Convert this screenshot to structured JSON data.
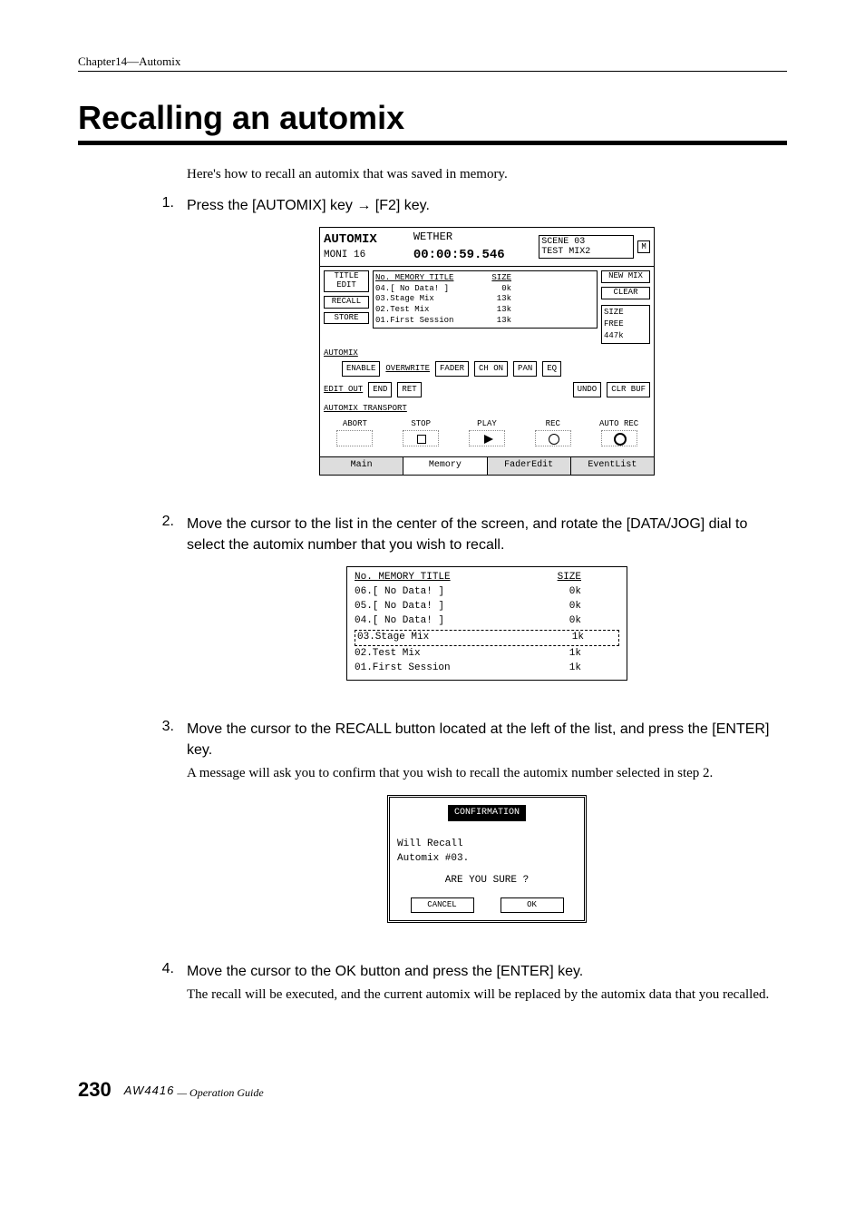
{
  "chapter_line": "Chapter14—Automix",
  "heading": "Recalling an automix",
  "intro": "Here's how to recall an automix that was saved in memory.",
  "steps": [
    {
      "num": "1.",
      "cmd": "Press the [AUTOMIX] key → [F2] key."
    },
    {
      "num": "2.",
      "cmd": "Move the cursor to the list in the center of the screen, and rotate the [DATA/JOG] dial to select the automix number that you wish to recall."
    },
    {
      "num": "3.",
      "cmd": "Move the cursor to the RECALL button located at the left of the list, and press the [ENTER] key.",
      "sub": "A message will ask you to confirm that you wish to recall the automix number selected in step 2."
    },
    {
      "num": "4.",
      "cmd": "Move the cursor to the OK button and press the [ENTER] key.",
      "sub": "The recall will be executed, and the current automix will be replaced by the automix data that you recalled."
    }
  ],
  "lcd_main": {
    "top_left_1": "AUTOMIX",
    "top_left_2": "MONI 16",
    "tc_label": "WETHER",
    "timecode": "00:00:59.546",
    "scene_label": "SCENE",
    "scene_num": "03",
    "scene_name": "TEST MIX2",
    "m": "M",
    "side": {
      "title": "TITLE\nEDIT",
      "recall": "RECALL",
      "store": "STORE"
    },
    "list_hdr_no": "No.  MEMORY TITLE",
    "list_hdr_sz": "SIZE",
    "rows": [
      {
        "t": "04.[   No Data!   ]",
        "s": "0k"
      },
      {
        "t": "03.Stage Mix",
        "s": "13k"
      },
      {
        "t": "02.Test Mix",
        "s": "13k"
      },
      {
        "t": "01.First Session",
        "s": "13k"
      }
    ],
    "right": {
      "new": "NEW\nMIX",
      "clear": "CLEAR",
      "size_label": "SIZE",
      "free": "FREE  447k"
    },
    "automix_label": "AUTOMIX",
    "overwrite_label": "OVERWRITE",
    "ow_btns": {
      "enable": "ENABLE",
      "fader": "FADER",
      "chon": "CH ON",
      "pan": "PAN",
      "eq": "EQ"
    },
    "editout_label": "EDIT OUT",
    "editout_btns": {
      "end": "END",
      "ret": "RET",
      "undo": "UNDO",
      "clrbuf": "CLR BUF"
    },
    "transport_label": "AUTOMIX TRANSPORT",
    "transport": {
      "abort": "ABORT",
      "stop": "STOP",
      "play": "PLAY",
      "rec": "REC",
      "autorec": "AUTO REC"
    },
    "tabs": {
      "main": "Main",
      "memory": "Memory",
      "fader": "FaderEdit",
      "event": "EventList"
    }
  },
  "lcd_list": {
    "hdr_title": "No.  MEMORY TITLE",
    "hdr_size": "SIZE",
    "rows": [
      {
        "t": "06.[   No Data!   ]",
        "s": "0k"
      },
      {
        "t": "05.[   No Data!   ]",
        "s": "0k"
      },
      {
        "t": "04.[   No Data!   ]",
        "s": "0k"
      },
      {
        "t": "03.Stage Mix",
        "s": "1k",
        "sel": true
      },
      {
        "t": "02.Test Mix",
        "s": "1k"
      },
      {
        "t": "01.First Session",
        "s": "1k"
      }
    ]
  },
  "lcd_confirm": {
    "title": "CONFIRMATION",
    "line1": "Will Recall",
    "line2": "Automix  #03.",
    "line3": "ARE YOU SURE ?",
    "cancel": "CANCEL",
    "ok": "OK"
  },
  "footer": {
    "page": "230",
    "model": "AW4416",
    "guide": " — Operation Guide"
  }
}
